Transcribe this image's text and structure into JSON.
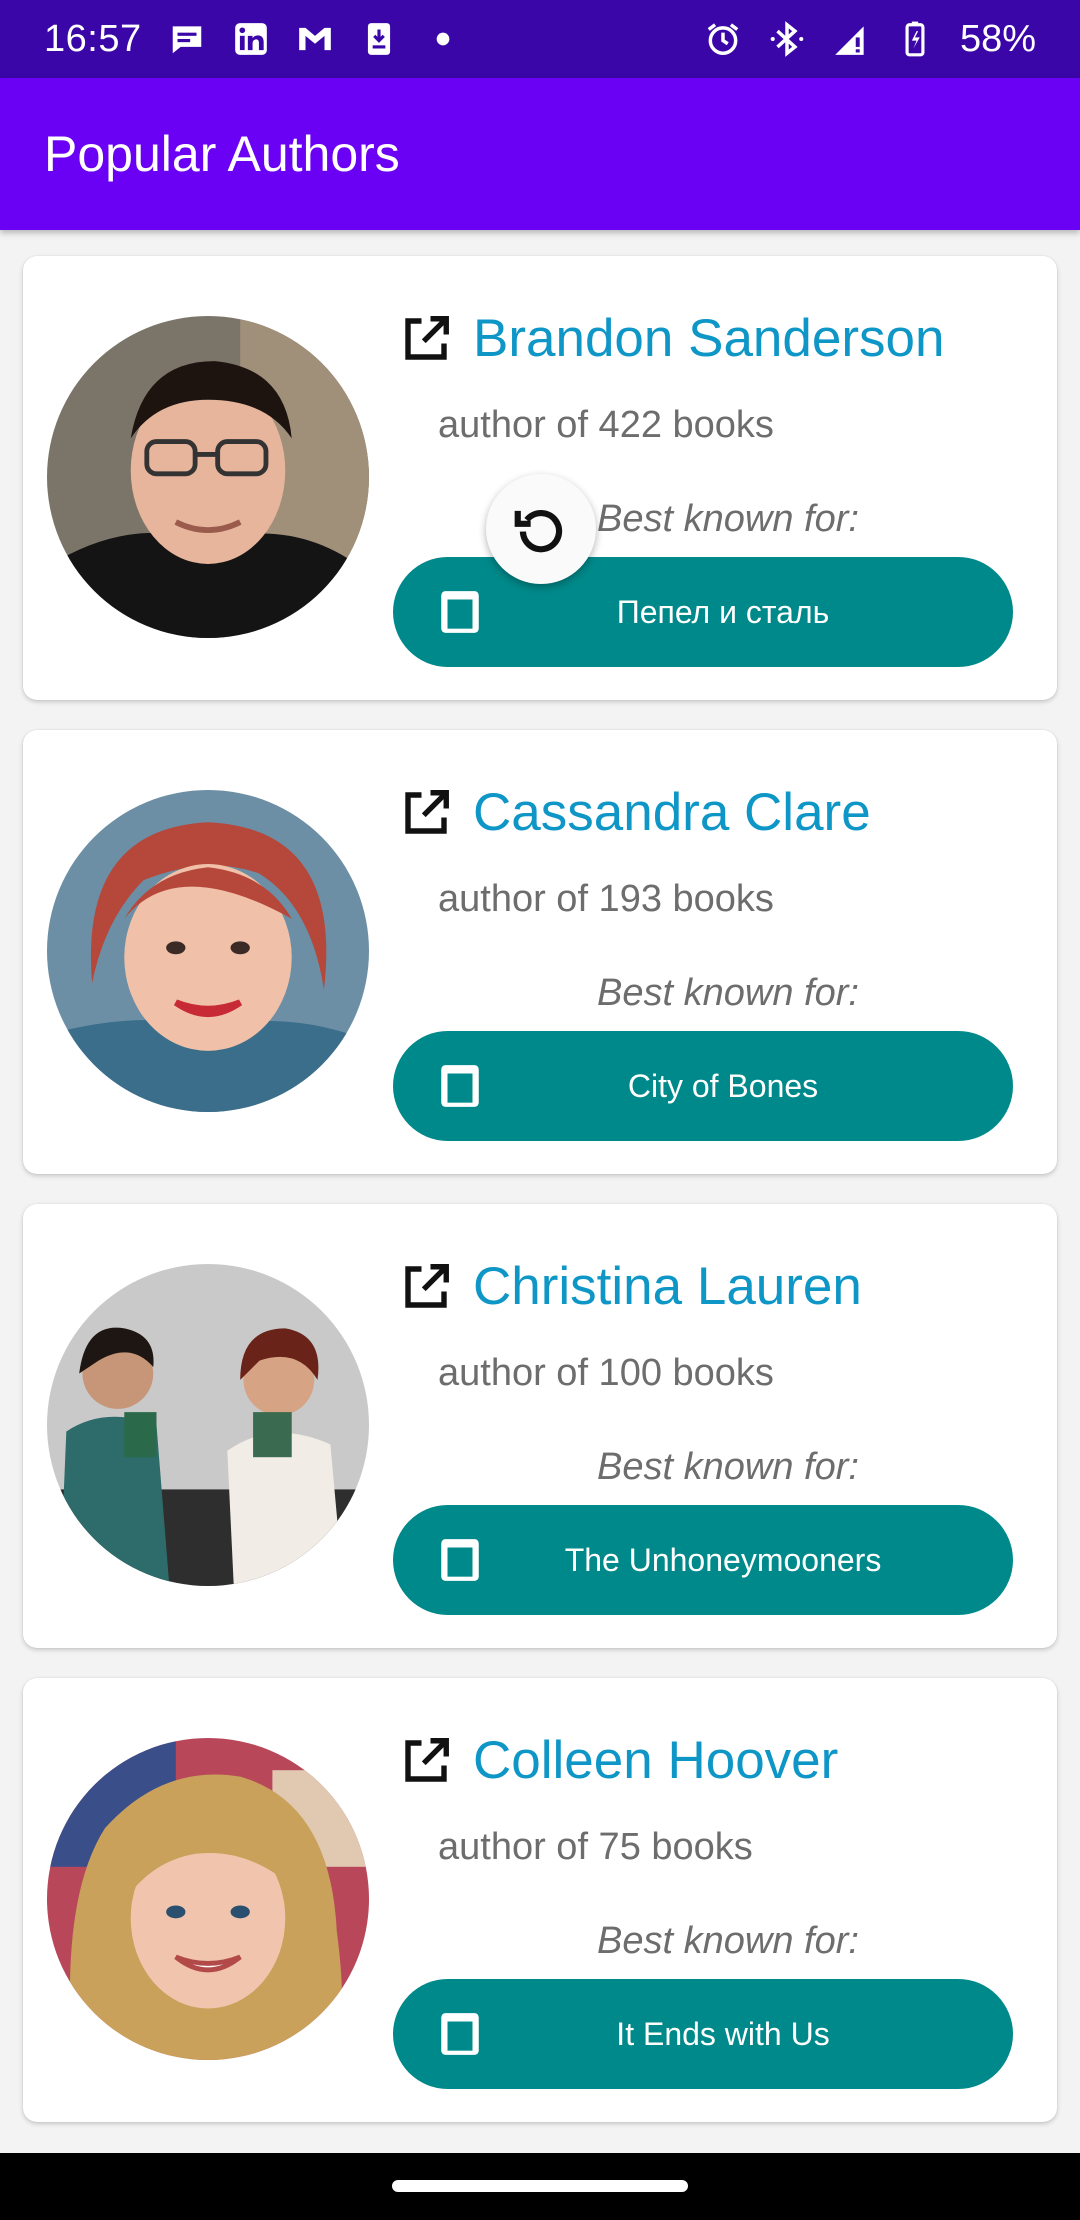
{
  "status_bar": {
    "time": "16:57",
    "battery_percent": "58%",
    "left_icons": [
      "message-icon",
      "linkedin-icon",
      "gmail-icon",
      "download-icon",
      "dot-icon"
    ],
    "right_icons": [
      "alarm-icon",
      "bluetooth-icon",
      "signal-icon",
      "battery-icon"
    ]
  },
  "app_bar": {
    "title": "Popular Authors"
  },
  "authors": [
    {
      "name": "Brandon Sanderson",
      "book_count": "author of 422 books",
      "best_known_label": "Best known for:",
      "best_known_title": "Пепел и сталь"
    },
    {
      "name": "Cassandra Clare",
      "book_count": "author of 193 books",
      "best_known_label": "Best known for:",
      "best_known_title": "City of Bones"
    },
    {
      "name": "Christina Lauren",
      "book_count": "author of 100 books",
      "best_known_label": "Best known for:",
      "best_known_title": "The Unhoneymooners"
    },
    {
      "name": "Colleen Hoover",
      "book_count": "author of 75 books",
      "best_known_label": "Best known for:",
      "best_known_title": "It Ends with Us"
    }
  ],
  "colors": {
    "status_bar": "#3a06a8",
    "app_bar": "#6a00f4",
    "author_name": "#0e96c7",
    "book_button": "#00898a"
  }
}
